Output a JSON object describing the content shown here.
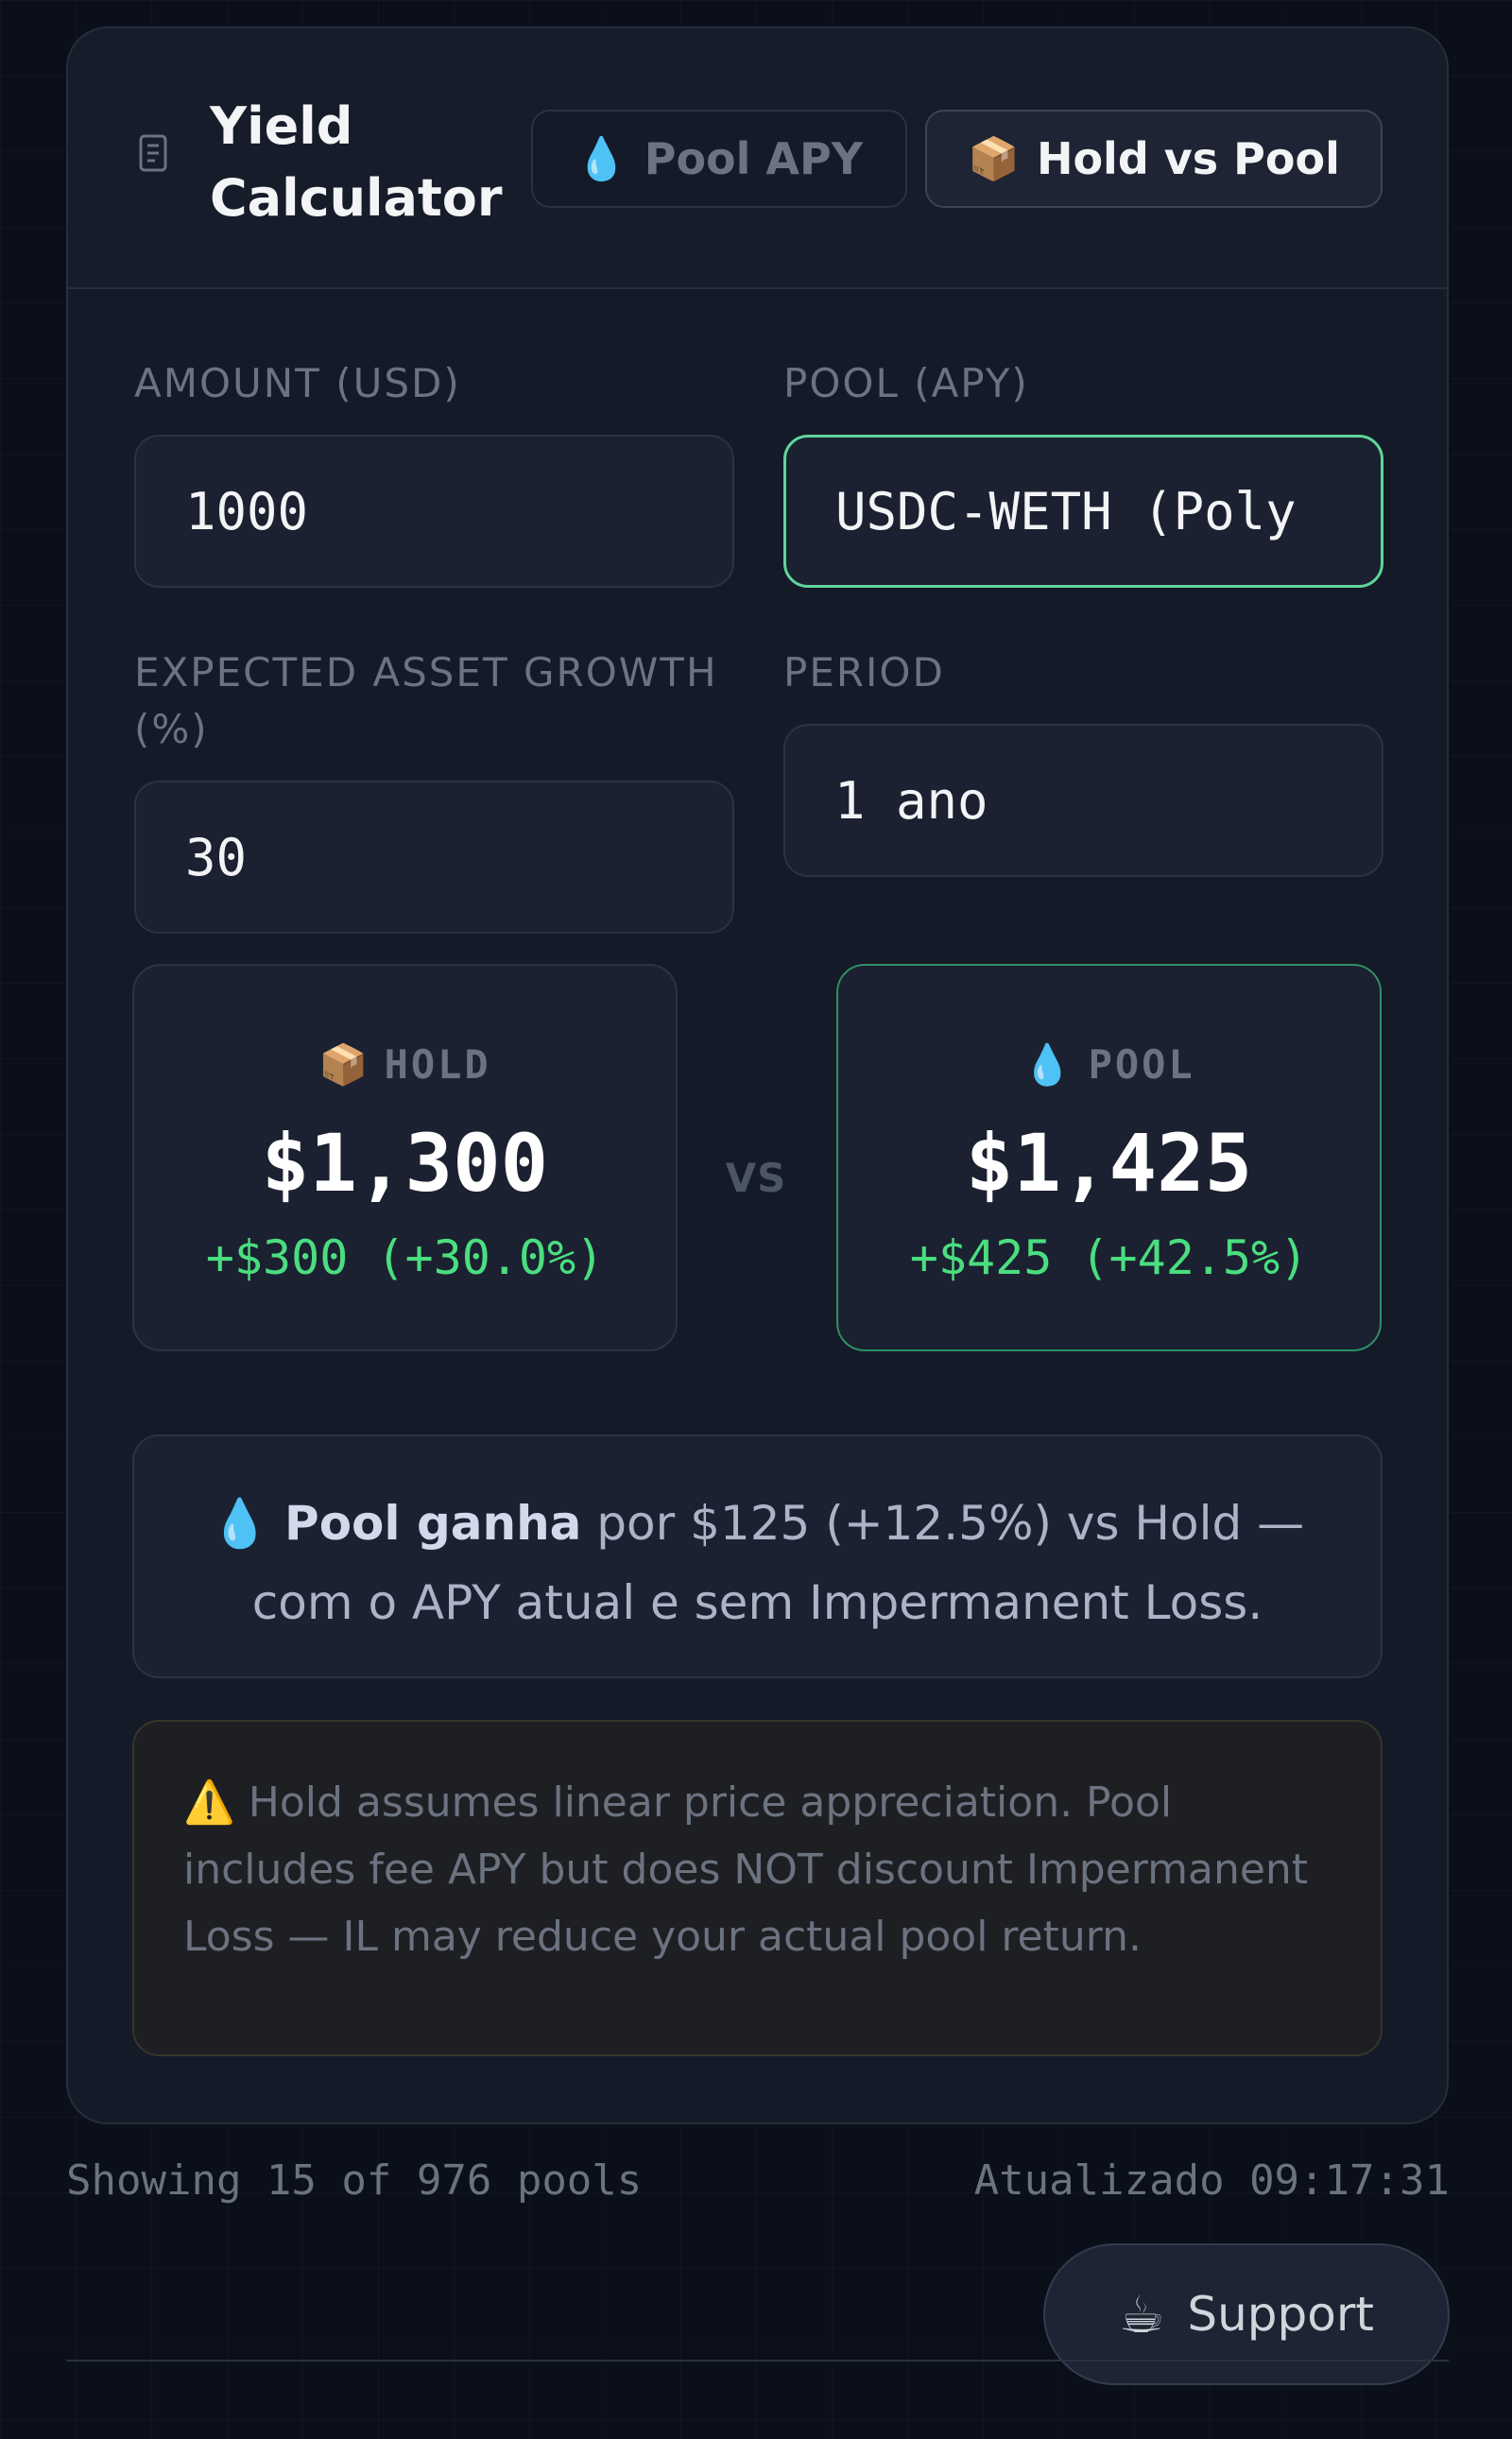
{
  "header": {
    "title": "Yield Calculator",
    "icon": "document-icon",
    "tabs": [
      {
        "emoji": "💧",
        "label": "Pool APY",
        "active": false
      },
      {
        "emoji": "📦",
        "label": "Hold vs Pool",
        "active": true
      }
    ]
  },
  "form": {
    "amount_label": "AMOUNT (USD)",
    "amount_value": "1000",
    "pool_label": "POOL (APY)",
    "pool_value": "USDC-WETH (Poly",
    "growth_label": "EXPECTED ASSET GROWTH (%)",
    "growth_value": "30",
    "period_label": "PERIOD",
    "period_value": "1 ano"
  },
  "comparison": {
    "hold": {
      "emoji": "📦",
      "label": "HOLD",
      "value": "$1,300",
      "diff": "+$300 (+30.0%)"
    },
    "vs": "VS",
    "pool": {
      "emoji": "💧",
      "label": "POOL",
      "value": "$1,425",
      "diff": "+$425 (+42.5%)"
    }
  },
  "summary": {
    "emoji": "💧",
    "strong": "Pool ganha",
    "text": " por $125 (+12.5%) vs Hold — com o APY atual e sem Impermanent Loss."
  },
  "warning": {
    "emoji": "⚠️",
    "text": " Hold assumes linear price appreciation. Pool includes fee APY but does NOT discount Impermanent Loss — IL may reduce your actual pool return."
  },
  "footer": {
    "count_text": "Showing 15 of 976 pools",
    "updated_text": "Atualizado 09:17:31"
  },
  "support": {
    "emoji": "☕",
    "label": "Support"
  },
  "colors": {
    "accent_green": "#4ade80",
    "background": "#0b0f19",
    "card": "#141a27"
  }
}
